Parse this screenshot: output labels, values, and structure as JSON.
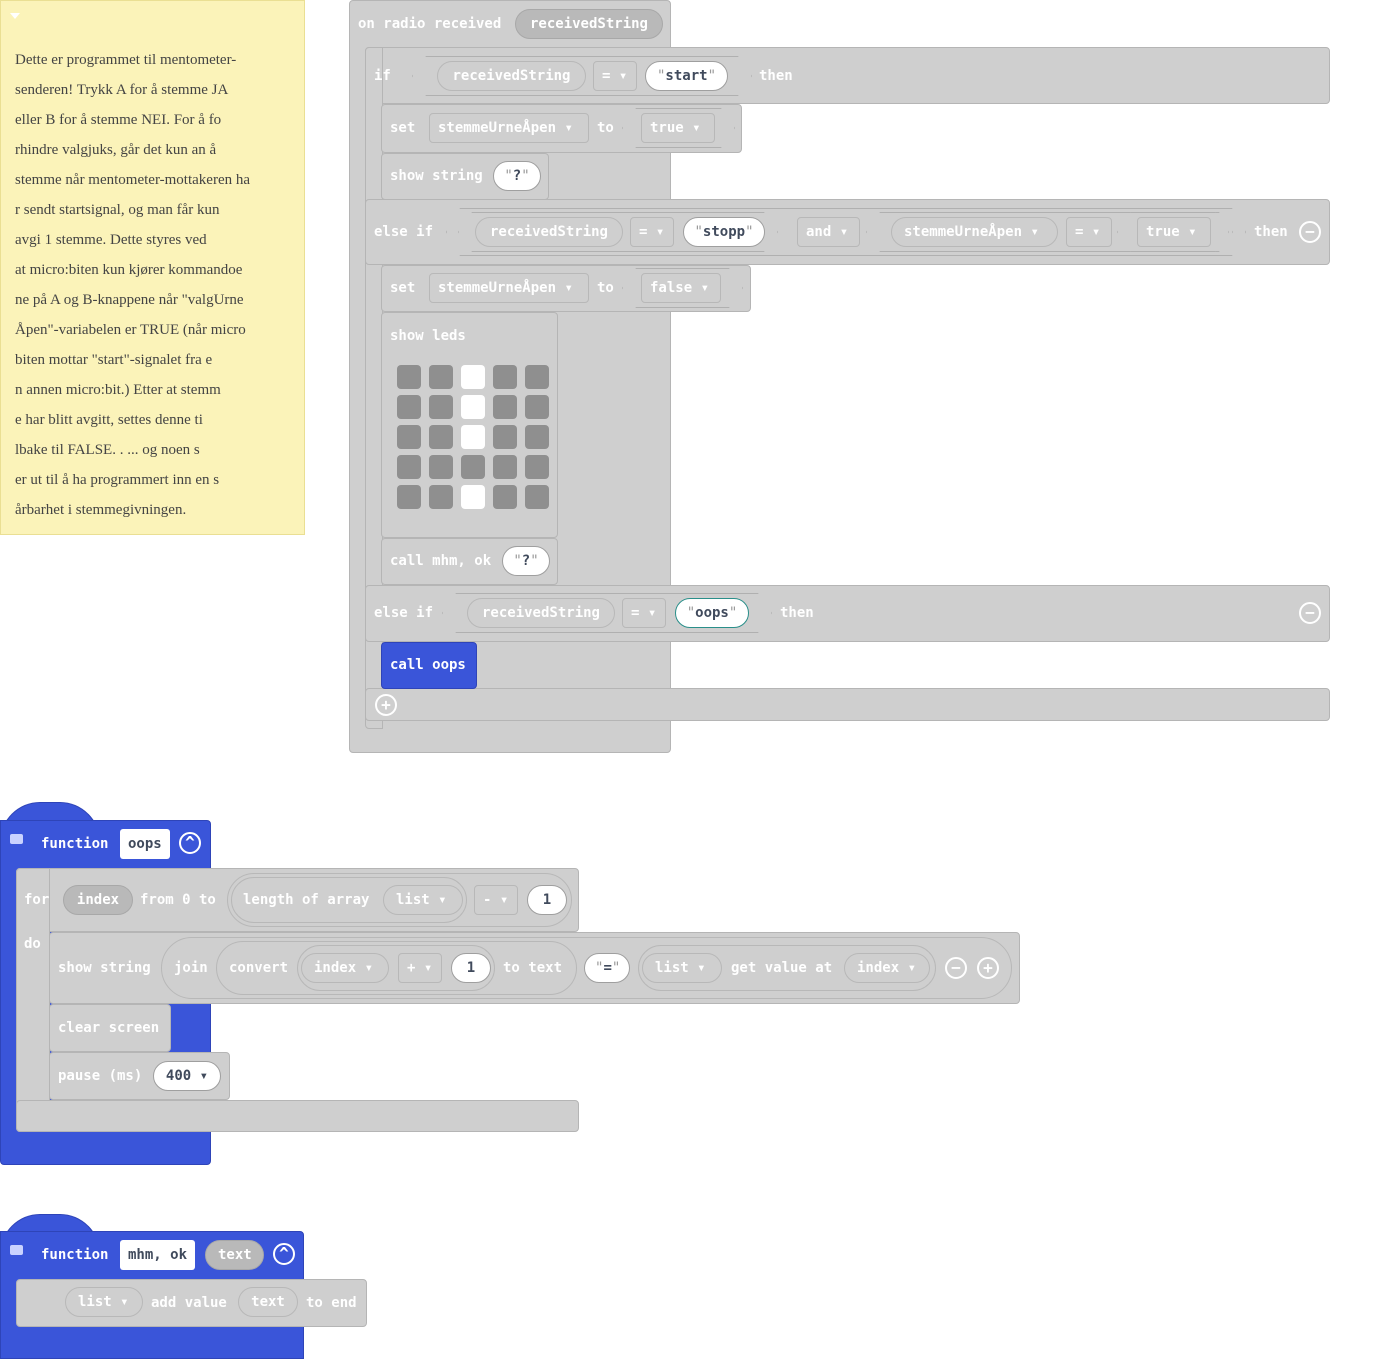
{
  "comment": {
    "lines": [
      "Dette er programmet til mentometer-",
      "senderen! Trykk A for å stemme JA",
      "eller B for å stemme NEI. For å fo",
      "rhindre valgjuks, går det kun an å",
      "stemme når mentometer-mottakeren ha",
      "r sendt startsignal, og man får kun",
      "avgi 1 stemme. Dette styres ved",
      "at micro:biten kun kjører kommandoe",
      "ne på A og B-knappene når \"valgUrne",
      "Åpen\"-variabelen er TRUE (når micro",
      "biten mottar \"start\"-signalet fra e",
      "n annen micro:bit.) Etter at stemm",
      "e har blitt avgitt, settes denne ti",
      "lbake til FALSE. . ... og noen s",
      "er ut til å ha programmert inn en s",
      "årbarhet i stemmegivningen."
    ]
  },
  "radio": {
    "header": "on radio received",
    "param": "receivedString",
    "if_kw": "if",
    "then_kw": "then",
    "else_if_kw": "else if",
    "and_kw": "and",
    "var": "receivedString",
    "op_eq": "=",
    "lit_start": "start",
    "lit_stopp": "stopp",
    "lit_oops": "oops",
    "set_kw": "set",
    "to_kw": "to",
    "state_var": "stemmeUrneÅpen",
    "true_val": "true",
    "false_val": "false",
    "show_string": "show string",
    "question": "?",
    "show_leds": "show leds",
    "call_mhm": "call mhm, ok",
    "call_oops": "call oops",
    "leds": [
      [
        0,
        0,
        1,
        0,
        0
      ],
      [
        0,
        0,
        1,
        0,
        0
      ],
      [
        0,
        0,
        1,
        0,
        0
      ],
      [
        0,
        0,
        0,
        0,
        0
      ],
      [
        0,
        0,
        1,
        0,
        0
      ]
    ]
  },
  "fn_oops": {
    "function_kw": "function",
    "name": "oops",
    "for_kw": "for",
    "index": "index",
    "from_to": "from 0 to",
    "length_of_array": "length of array",
    "list": "list",
    "minus": "-",
    "one": "1",
    "do_kw": "do",
    "show_string": "show string",
    "join": "join",
    "convert": "convert",
    "plus": "+",
    "to_text": "to text",
    "equals_lit": "=",
    "get_value_at": "get value at",
    "clear_screen": "clear screen",
    "pause": "pause (ms)",
    "pause_value": "400"
  },
  "fn_mhm": {
    "function_kw": "function",
    "name": "mhm, ok",
    "param": "text",
    "list": "list",
    "add_value": "add value",
    "text": "text",
    "to_end": "to end"
  }
}
